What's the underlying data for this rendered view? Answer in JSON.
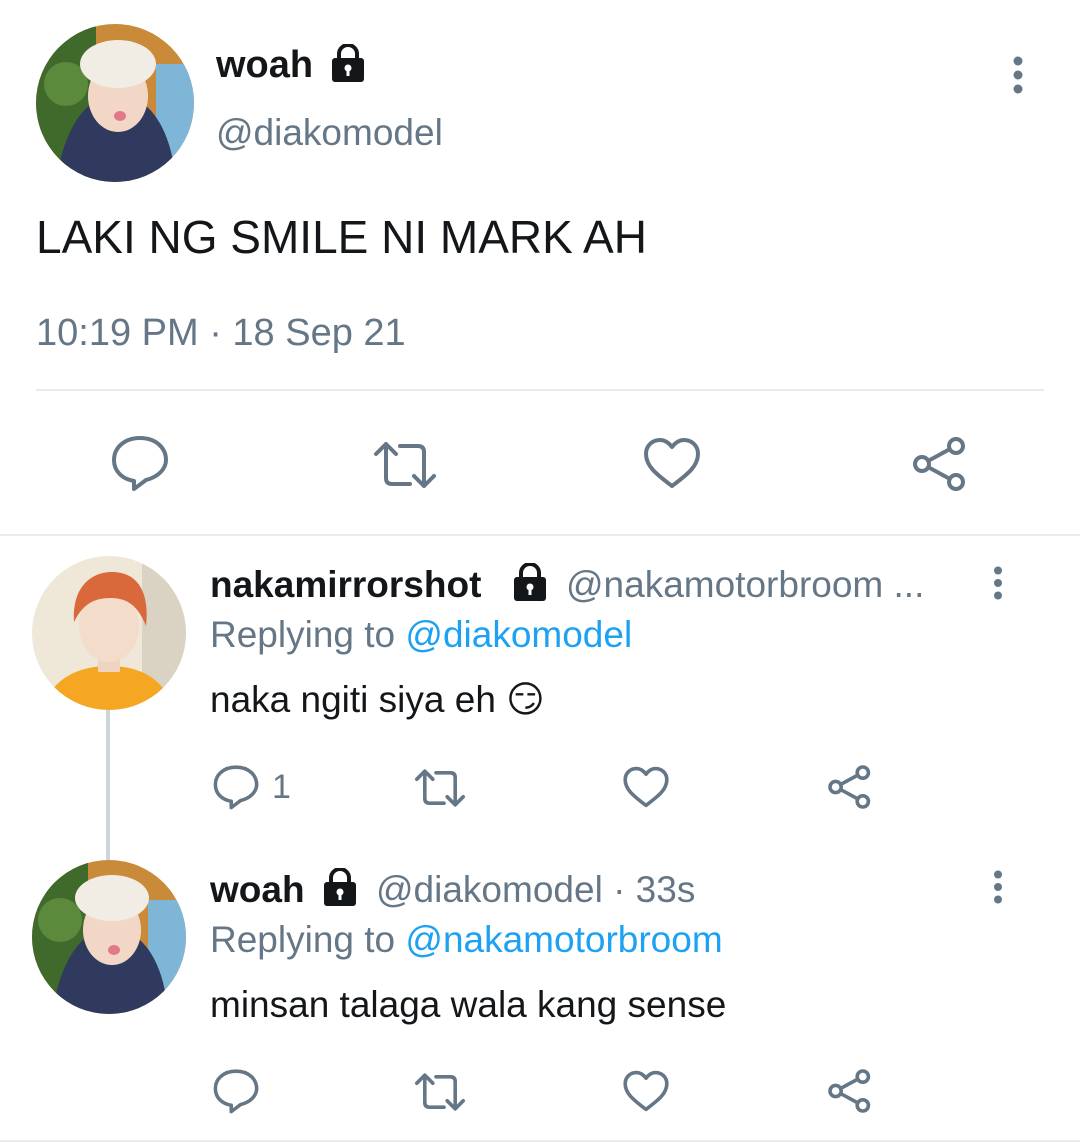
{
  "main_tweet": {
    "display_name": "woah",
    "handle": "@diakomodel",
    "text": "LAKI NG SMILE NI MARK AH",
    "timestamp": "10:19 PM · 18 Sep 21",
    "actions": [
      "reply-icon",
      "retweet-icon",
      "like-icon",
      "share-icon"
    ]
  },
  "replies": [
    {
      "display_name": "nakamirrorshot",
      "handle": "@nakamotorbroom ...",
      "replying_prefix": "Replying to",
      "replying_to": "@diakomodel",
      "text": "naka ngiti siya eh 😏",
      "reply_count": "1"
    },
    {
      "display_name": "woah",
      "handle": "@diakomodel",
      "time": "· 33s",
      "replying_prefix": "Replying to",
      "replying_to": "@nakamotorbroom",
      "text": "minsan talaga wala kang sense",
      "reply_count": ""
    }
  ],
  "colors": {
    "text": "#14171a",
    "muted": "#657786",
    "link": "#1da1f2",
    "divider": "#e6ecf0"
  }
}
